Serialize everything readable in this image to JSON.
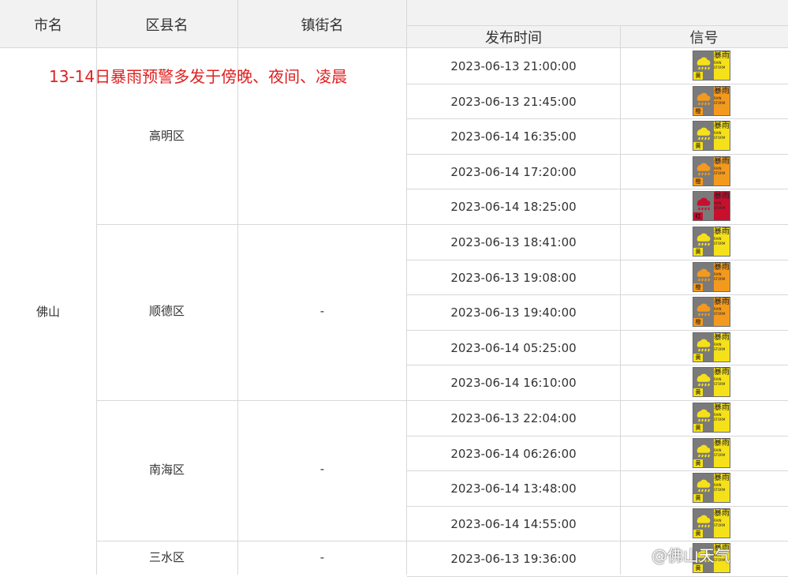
{
  "header": {
    "city": "市名",
    "district": "区县名",
    "town": "镇街名",
    "time": "发布时间",
    "signal": "信号"
  },
  "annotation": "13-14日暴雨预警多发于傍晚、夜间、凌晨",
  "city": "佛山",
  "districts": [
    {
      "name": "高明区",
      "town": ""
    },
    {
      "name": "顺德区",
      "town": "-"
    },
    {
      "name": "南海区",
      "town": "-"
    },
    {
      "name": "三水区",
      "town": "-"
    }
  ],
  "signal_text": {
    "cn": "暴雨",
    "en": "RAIN STORM"
  },
  "levels": {
    "yellow": {
      "label": "黄",
      "color": "#f5e11a"
    },
    "orange": {
      "label": "橙",
      "color": "#f39a1e"
    },
    "red": {
      "label": "红",
      "color": "#c8102e"
    }
  },
  "rows": [
    {
      "time": "2023-06-13 21:00:00",
      "level": "yellow"
    },
    {
      "time": "2023-06-13 21:45:00",
      "level": "orange"
    },
    {
      "time": "2023-06-14 16:35:00",
      "level": "yellow"
    },
    {
      "time": "2023-06-14 17:20:00",
      "level": "orange"
    },
    {
      "time": "2023-06-14 18:25:00",
      "level": "red"
    },
    {
      "time": "2023-06-13 18:41:00",
      "level": "yellow"
    },
    {
      "time": "2023-06-13 19:08:00",
      "level": "orange"
    },
    {
      "time": "2023-06-13 19:40:00",
      "level": "orange"
    },
    {
      "time": "2023-06-14 05:25:00",
      "level": "yellow"
    },
    {
      "time": "2023-06-14 16:10:00",
      "level": "yellow"
    },
    {
      "time": "2023-06-13 22:04:00",
      "level": "yellow"
    },
    {
      "time": "2023-06-14 06:26:00",
      "level": "yellow"
    },
    {
      "time": "2023-06-14 13:48:00",
      "level": "yellow"
    },
    {
      "time": "2023-06-14 14:55:00",
      "level": "yellow"
    },
    {
      "time": "2023-06-13 19:36:00",
      "level": "yellow"
    }
  ],
  "watermark": "@佛山天气"
}
